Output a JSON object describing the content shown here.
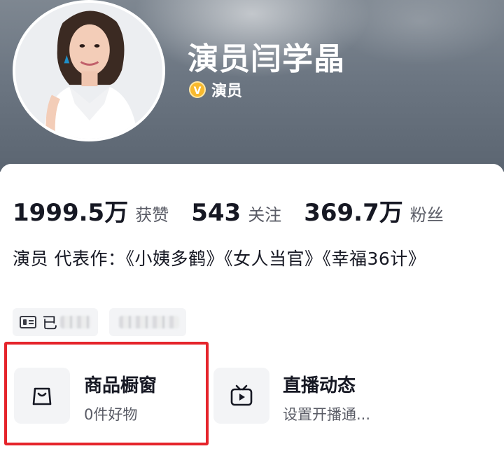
{
  "profile": {
    "name": "演员闫学晶",
    "verify_badge": "V",
    "verify_label": "演员"
  },
  "stats": [
    {
      "value": "1999.5万",
      "label": "获赞"
    },
    {
      "value": "543",
      "label": "关注"
    },
    {
      "value": "369.7万",
      "label": "粉丝"
    }
  ],
  "bio": "演员 代表作：《小姨多鹤》《女人当官》《幸福36计》",
  "tags": [
    {
      "text": "已",
      "icon": "id-card-icon"
    }
  ],
  "tiles": [
    {
      "title": "商品橱窗",
      "subtitle": "0件好物",
      "icon": "shopping-bag-icon",
      "highlighted": true
    },
    {
      "title": "直播动态",
      "subtitle": "设置开播通...",
      "icon": "tv-play-icon",
      "highlighted": false
    }
  ],
  "colors": {
    "highlight": "#e5242b",
    "verify": "#f8b92d",
    "text_primary": "#161823",
    "text_secondary": "#5a5c66"
  }
}
